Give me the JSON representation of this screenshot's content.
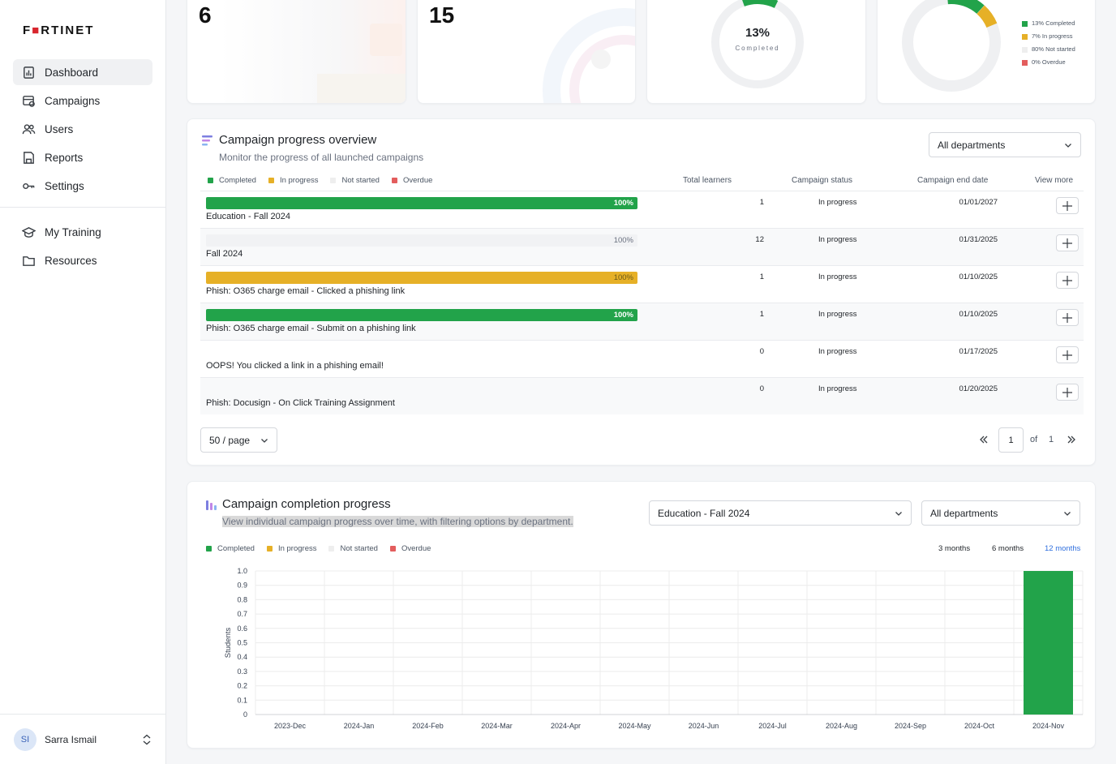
{
  "sidebar": {
    "logo": "FORTINET",
    "items": [
      {
        "label": "Dashboard",
        "icon": "dashboard-icon"
      },
      {
        "label": "Campaigns",
        "icon": "campaigns-icon"
      },
      {
        "label": "Users",
        "icon": "users-icon"
      },
      {
        "label": "Reports",
        "icon": "reports-icon"
      },
      {
        "label": "Settings",
        "icon": "settings-icon"
      }
    ],
    "items2": [
      {
        "label": "My Training",
        "icon": "graduation-cap-icon"
      },
      {
        "label": "Resources",
        "icon": "folder-icon"
      }
    ],
    "user": {
      "initials": "SI",
      "name": "Sarra Ismail"
    }
  },
  "stats": {
    "card1_value": "6",
    "card2_value": "15",
    "card3_percent": "13%",
    "card3_label": "Completed",
    "card4_legend": [
      "13% Completed",
      "7% In progress",
      "80% Not started",
      "0% Overdue"
    ]
  },
  "overview": {
    "title": "Campaign progress overview",
    "subtitle": "Monitor the progress of all launched campaigns",
    "department_select": "All departments",
    "legend": [
      "Completed",
      "In progress",
      "Not started",
      "Overdue"
    ],
    "headers": {
      "learners": "Total learners",
      "status": "Campaign status",
      "end_date": "Campaign end date",
      "view_more": "View more"
    },
    "rows": [
      {
        "name": "Education - Fall 2024",
        "progress": "100%",
        "type": "completed",
        "learners": "1",
        "status": "In progress",
        "end_date": "01/01/2027"
      },
      {
        "name": "Fall 2024",
        "progress": "100%",
        "type": "notstarted",
        "learners": "12",
        "status": "In progress",
        "end_date": "01/31/2025"
      },
      {
        "name": "Phish: O365 charge email - Clicked a phishing link",
        "progress": "100%",
        "type": "inprogress",
        "learners": "1",
        "status": "In progress",
        "end_date": "01/10/2025"
      },
      {
        "name": "Phish: O365 charge email - Submit on a phishing link",
        "progress": "100%",
        "type": "completed",
        "learners": "1",
        "status": "In progress",
        "end_date": "01/10/2025"
      },
      {
        "name": "OOPS! You clicked a link in a phishing email!",
        "progress": "",
        "type": "empty",
        "learners": "0",
        "status": "In progress",
        "end_date": "01/17/2025"
      },
      {
        "name": "Phish: Docusign - On Click Training Assignment",
        "progress": "",
        "type": "empty",
        "learners": "0",
        "status": "In progress",
        "end_date": "01/20/2025"
      }
    ],
    "page_size": "50 / page",
    "page": "1",
    "of_label": "of",
    "total_pages": "1"
  },
  "completion": {
    "title": "Campaign completion progress",
    "subtitle": "View individual campaign progress over time, with filtering options by department.",
    "campaign_select": "Education - Fall 2024",
    "department_select": "All departments",
    "legend": [
      "Completed",
      "In progress",
      "Not started",
      "Overdue"
    ],
    "ranges": [
      "3 months",
      "6 months",
      "12 months"
    ],
    "selected_range": "12 months"
  },
  "colors": {
    "completed": "#22a34a",
    "in_progress": "#e6b027",
    "not_started": "#eeeeee",
    "overdue": "#e35d5d",
    "accent": "#2f6fde"
  },
  "chart_data": {
    "type": "bar",
    "title": "",
    "xlabel": "",
    "ylabel": "Students",
    "ylim": [
      0,
      1.0
    ],
    "yticks": [
      "1.0",
      "0.9",
      "0.8",
      "0.7",
      "0.6",
      "0.5",
      "0.4",
      "0.3",
      "0.2",
      "0.1",
      "0"
    ],
    "categories": [
      "2023-Dec",
      "2024-Jan",
      "2024-Feb",
      "2024-Mar",
      "2024-Apr",
      "2024-May",
      "2024-Jun",
      "2024-Jul",
      "2024-Aug",
      "2024-Sep",
      "2024-Oct",
      "2024-Nov"
    ],
    "series": [
      {
        "name": "Completed",
        "values": [
          0,
          0,
          0,
          0,
          0,
          0,
          0,
          0,
          0,
          0,
          0,
          1
        ]
      }
    ],
    "grid": true
  }
}
